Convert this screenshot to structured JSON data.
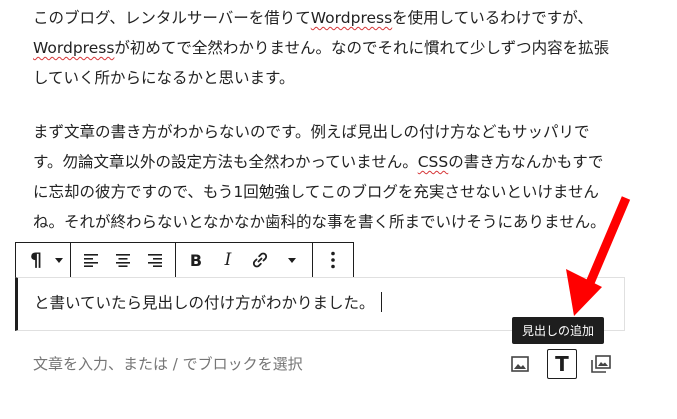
{
  "post": {
    "para1": {
      "before1": "このブログ、レンタルサーバーを借りて",
      "wp1": "Wordpress",
      "after1": "を使用しているわけですが、",
      "wp2": "Wordpress",
      "after2": "が初めてで全然わかりません。なのでそれに慣れて少しずつ内容を拡張していく所からになるかと思います。"
    },
    "para2": {
      "before": "まず文章の書き方がわからないのです。例えば見出しの付け方などもサッパリです。勿論文章以外の設定方法も全然わかっていません。",
      "css": "CSS",
      "after": "の書き方なんかもすでに忘却の彼方ですので、もう1回勉強してこのブログを充実させないといけませんね。それが終わらないとなかなか歯科的な事を書く所までいけそうにありません。"
    },
    "current_block_text": "と書いていたら見出しの付け方がわかりました。"
  },
  "toolbar": {
    "items": [
      "paragraph-block-type",
      "align-left",
      "align-center",
      "align-right",
      "bold",
      "italic",
      "link",
      "more-rich-text",
      "more-options"
    ],
    "bold_glyph": "B",
    "italic_glyph": "I",
    "paragraph_glyph": "¶"
  },
  "appender": {
    "placeholder": "文章を入力、または / でブロックを選択",
    "heading_glyph": "T"
  },
  "tooltip": {
    "text": "見出しの追加"
  },
  "colors": {
    "annotation_arrow": "#ff0000",
    "squiggle": "#d63638",
    "tooltip_bg": "#1e1e1e"
  }
}
